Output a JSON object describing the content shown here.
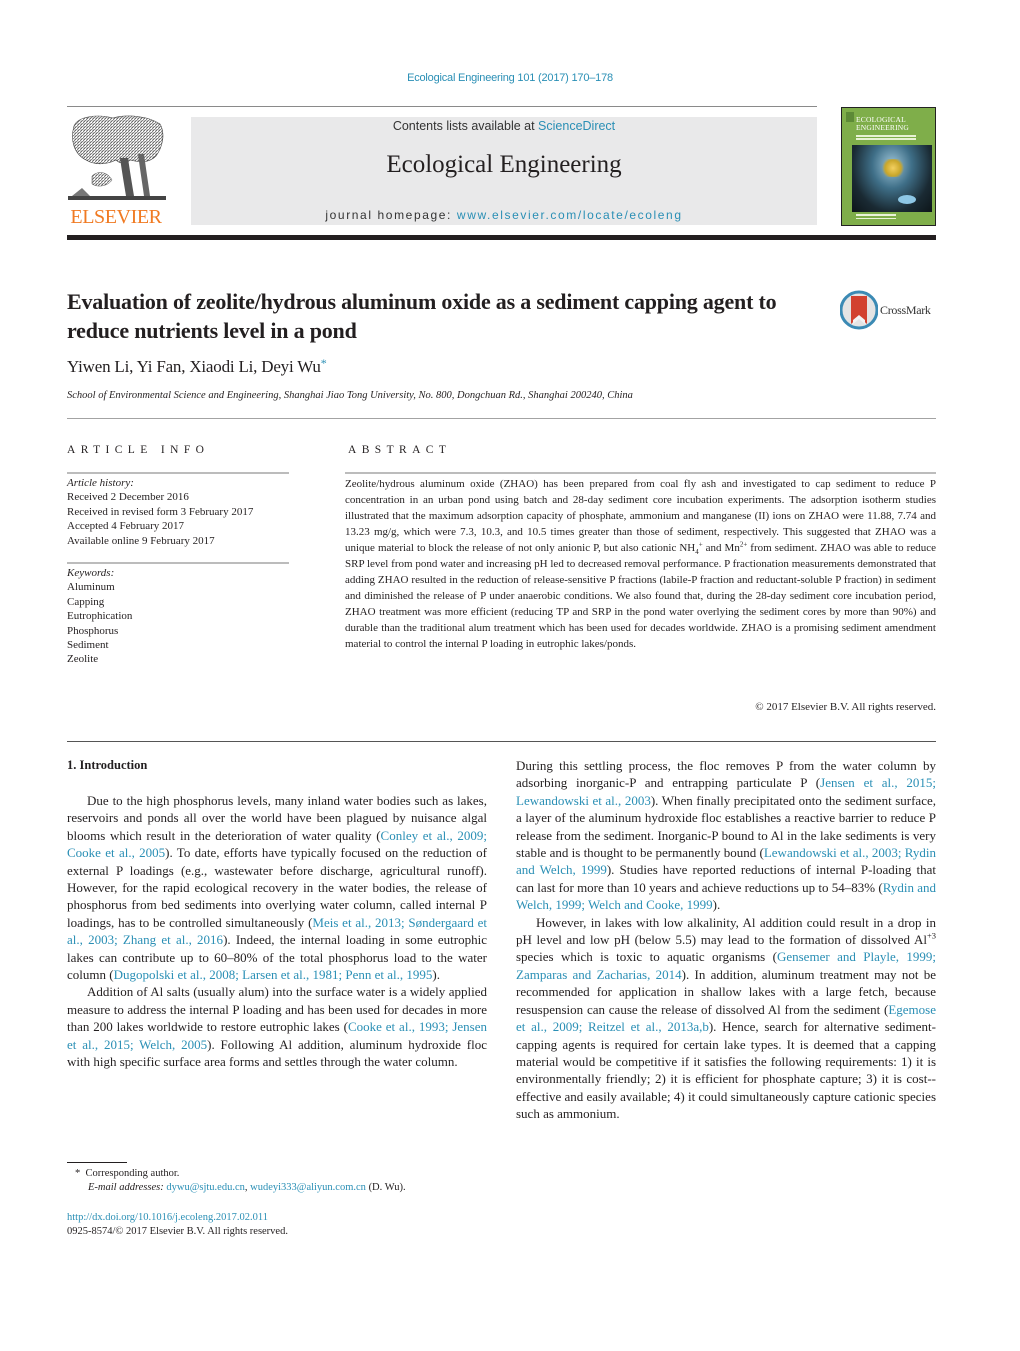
{
  "journal_citation": "Ecological Engineering 101 (2017) 170–178",
  "header": {
    "publisher_logo_text": "ELSEVIER",
    "contents_prefix": "Contents lists available at ",
    "contents_link": "ScienceDirect",
    "journal_title": "Ecological Engineering",
    "homepage_prefix": "journal homepage: ",
    "homepage_link": "www.elsevier.com/locate/ecoleng",
    "cover_title_line1": "ECOLOGICAL",
    "cover_title_line2": "ENGINEERING"
  },
  "article": {
    "title": "Evaluation of zeolite/hydrous aluminum oxide as a sediment capping agent to reduce nutrients level in a pond",
    "crossmark_label": "CrossMark",
    "authors": "Yiwen Li, Yi Fan, Xiaodi Li, Deyi Wu",
    "corresponding_marker": "*",
    "affiliation": "School of Environmental Science and Engineering, Shanghai Jiao Tong University, No. 800, Dongchuan Rd., Shanghai 200240, China"
  },
  "article_info": {
    "heading": "ARTICLE INFO",
    "history_label": "Article history:",
    "history": [
      "Received 2 December 2016",
      "Received in revised form 3 February 2017",
      "Accepted 4 February 2017",
      "Available online 9 February 2017"
    ],
    "keywords_label": "Keywords:",
    "keywords": [
      "Aluminum",
      "Capping",
      "Eutrophication",
      "Phosphorus",
      "Sediment",
      "Zeolite"
    ]
  },
  "abstract": {
    "heading": "ABSTRACT",
    "text_part1": "Zeolite/hydrous aluminum oxide (ZHAO) has been prepared from coal fly ash and investigated to cap sediment to reduce P concentration in an urban pond using batch and 28-day sediment core incubation experiments. The adsorption isotherm studies illustrated that the maximum adsorption capacity of phosphate, ammonium and manganese (II) ions on ZHAO were 11.88, 7.74 and 13.23 mg/g, which were 7.3, 10.3, and 10.5 times greater than those of sediment, respectively. This suggested that ZHAO was a unique material to block the release of not only anionic P, but also cationic NH",
    "nh4_sub": "4",
    "nh4_sup": "+",
    "text_part2": " and Mn",
    "mn_sup": "2+",
    "text_part3": " from sediment. ZHAO was able to reduce SRP level from pond water and increasing pH led to decreased removal performance. P fractionation measurements demonstrated that adding ZHAO resulted in the reduction of release-sensitive P fractions (labile-P fraction and reductant-soluble P fraction) in sediment and diminished the release of P under anaerobic conditions. We also found that, during the 28-day sediment core incubation period, ZHAO treatment was more efficient (reducing TP and SRP in the pond water overlying the sediment cores by more than 90%) and durable than the traditional alum treatment which has been used for decades worldwide. ZHAO is a promising sediment amendment material to control the internal P loading in eutrophic lakes/ponds.",
    "copyright": "© 2017 Elsevier B.V. All rights reserved."
  },
  "introduction": {
    "heading": "1.  Introduction",
    "p1": [
      {
        "t": "Due to the high phosphorus levels, many inland water bodies such as lakes, reservoirs and ponds all over the world have been plagued by nuisance algal blooms which result in the deterioration of water quality ("
      },
      {
        "link": "Conley et al., 2009; Cooke et al., 2005"
      },
      {
        "t": "). To date, efforts have typically focused on the reduction of external P loadings (e.g., wastewater before discharge, agricultural runoff). However, for the rapid ecological recovery in the water bodies, the release of phosphorus from bed sediments into overlying water column, called internal P loadings, has to be controlled simultaneously ("
      },
      {
        "link": "Meis et al., 2013; Søndergaard et al., 2003; Zhang et al., 2016"
      },
      {
        "t": "). Indeed, the internal loading in some eutrophic lakes can contribute up to 60–80% of the total phosphorus load to the water column ("
      },
      {
        "link": "Dugopolski et al., 2008; Larsen et al., 1981; Penn et al., 1995"
      },
      {
        "t": ")."
      }
    ],
    "p2": [
      {
        "t": "Addition of Al salts (usually alum) into the surface water is a widely applied measure to address the internal P loading and has been used for decades in more than 200 lakes worldwide to restore eutrophic lakes ("
      },
      {
        "link": "Cooke et al., 1993; Jensen et al., 2015; Welch, 2005"
      },
      {
        "t": "). Following Al addition, aluminum hydroxide floc with high specific surface area forms and settles through the water column."
      }
    ],
    "p3": [
      {
        "t": "During this settling process, the floc removes P from the water column by adsorbing inorganic-P and entrapping particulate P ("
      },
      {
        "link": "Jensen et al., 2015; Lewandowski et al., 2003"
      },
      {
        "t": "). When finally precipitated onto the sediment surface, a layer of the aluminum hydroxide floc establishes a reactive barrier to reduce P release from the sediment. Inorganic-P bound to Al in the lake sediments is very stable and is thought to be permanently bound ("
      },
      {
        "link": "Lewandowski et al., 2003; Rydin and Welch, 1999"
      },
      {
        "t": "). Studies have reported reductions of internal P-loading that can last for more than 10 years and achieve reductions up to 54–83% ("
      },
      {
        "link": "Rydin and Welch, 1999; Welch and Cooke, 1999"
      },
      {
        "t": ")."
      }
    ],
    "p4": [
      {
        "t": "However, in lakes with low alkalinity, Al addition could result in a drop in pH level and low pH (below 5.5) may lead to the formation of dissolved Al"
      },
      {
        "sup": "+3"
      },
      {
        "t": " species which is toxic to aquatic organisms ("
      },
      {
        "link": "Gensemer and Playle, 1999; Zamparas and Zacharias, 2014"
      },
      {
        "t": "). In addition, aluminum treatment may not be recommended for application in shallow lakes with a large fetch, because resuspension can cause the release of dissolved Al from the sediment ("
      },
      {
        "link": "Egemose et al., 2009; Reitzel et al., 2013a,b"
      },
      {
        "t": "). Hence, search for alternative sediment- capping agents is required for certain lake types. It is deemed that a capping material would be competitive if it satisfies the following requirements: 1) it is environmentally friendly; 2) it is efficient for phosphate capture; 3) it is cost--effective and easily available; 4) it could simultaneously capture cationic species such as ammonium."
      }
    ]
  },
  "footnotes": {
    "marker": "*",
    "corresponding": "Corresponding author.",
    "email_label": "E-mail addresses:",
    "email1": "dywu@sjtu.edu.cn",
    "email2": "wudeyi333@aliyun.com.cn",
    "email_suffix": " (D. Wu).",
    "doi": "http://dx.doi.org/10.1016/j.ecoleng.2017.02.011",
    "issn_copyright": "0925-8574/© 2017 Elsevier B.V. All rights reserved."
  },
  "colors": {
    "link": "#2a8fb5",
    "elsevier_orange": "#f07a22",
    "header_box": "#e9e9ea"
  }
}
